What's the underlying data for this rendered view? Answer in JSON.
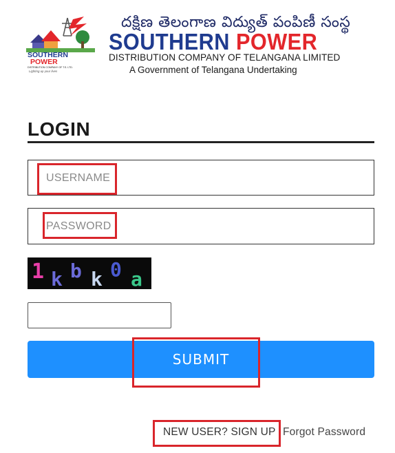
{
  "header": {
    "brand_telugu": "దక్షిణ తెలంగాణ విద్యుత్ పంపిణీ సంస్థ",
    "brand_southern": "SOUTHERN",
    "brand_power": "POWER",
    "brand_distribution": "DISTRIBUTION COMPANY OF TELANGANA LIMITED",
    "brand_undertaking": "A Government of Telangana Undertaking",
    "emblem": {
      "southern": "SOUTHERN",
      "power": "POWER",
      "company": "DISTRIBUTION COMPANY OF T.S. LTD.",
      "tagline": "Lighting up your lives"
    }
  },
  "login": {
    "title": "LOGIN",
    "username_placeholder": "USERNAME",
    "password_placeholder": "PASSWORD",
    "captcha_text": "1kbk0a",
    "submit_label": "SUBMIT"
  },
  "footer": {
    "signup_label": "NEW USER? SIGN UP",
    "forgot_label": "Forgot Password"
  },
  "colors": {
    "accent_blue": "#1e90ff",
    "brand_blue": "#1f3b8f",
    "brand_red": "#e3262b",
    "highlight_red": "#d9252b"
  }
}
